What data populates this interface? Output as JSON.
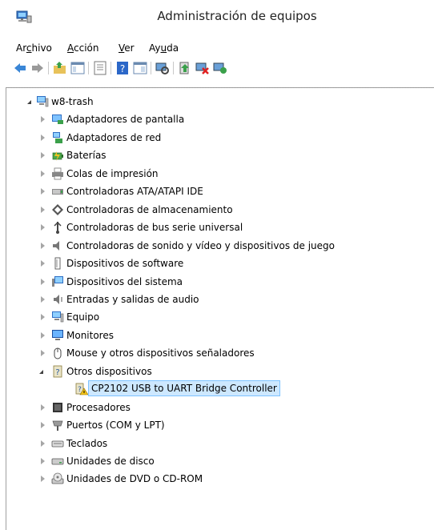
{
  "window": {
    "title": "Administración de equipos"
  },
  "menu": [
    {
      "pre": "Ar",
      "ul": "c",
      "post": "hivo"
    },
    {
      "pre": "",
      "ul": "A",
      "post": "cción"
    },
    {
      "pre": "",
      "ul": "V",
      "post": "er"
    },
    {
      "pre": "Ay",
      "ul": "u",
      "post": "da"
    }
  ],
  "toolbar": {
    "buttons": [
      "back-icon",
      "forward-icon",
      "up-folder-icon",
      "console-tree-icon",
      "properties-icon",
      "help-icon",
      "show-hide-icon",
      "scan-hardware-icon",
      "update-driver-icon",
      "uninstall-icon",
      "enable-device-icon"
    ]
  },
  "tree": {
    "root": "w8-trash",
    "items": [
      {
        "label": "Adaptadores de pantalla",
        "icon": "display-adapter-icon",
        "expanded": false
      },
      {
        "label": "Adaptadores de red",
        "icon": "network-adapter-icon",
        "expanded": false
      },
      {
        "label": "Baterías",
        "icon": "battery-icon",
        "expanded": false
      },
      {
        "label": "Colas de impresión",
        "icon": "printer-icon",
        "expanded": false
      },
      {
        "label": "Controladoras ATA/ATAPI IDE",
        "icon": "ide-controller-icon",
        "expanded": false
      },
      {
        "label": "Controladoras de almacenamiento",
        "icon": "storage-controller-icon",
        "expanded": false
      },
      {
        "label": "Controladoras de bus serie universal",
        "icon": "usb-icon",
        "expanded": false
      },
      {
        "label": "Controladoras de sonido y vídeo y dispositivos de juego",
        "icon": "sound-icon",
        "expanded": false
      },
      {
        "label": "Dispositivos de software",
        "icon": "software-device-icon",
        "expanded": false
      },
      {
        "label": "Dispositivos del sistema",
        "icon": "system-device-icon",
        "expanded": false
      },
      {
        "label": "Entradas y salidas de audio",
        "icon": "audio-io-icon",
        "expanded": false
      },
      {
        "label": "Equipo",
        "icon": "computer-icon",
        "expanded": false
      },
      {
        "label": "Monitores",
        "icon": "monitor-icon",
        "expanded": false
      },
      {
        "label": "Mouse y otros dispositivos señaladores",
        "icon": "mouse-icon",
        "expanded": false
      },
      {
        "label": "Otros dispositivos",
        "icon": "unknown-device-icon",
        "expanded": true,
        "children": [
          {
            "label": "CP2102 USB to UART Bridge Controller",
            "icon": "warning-device-icon",
            "selected": true
          }
        ]
      },
      {
        "label": "Procesadores",
        "icon": "processor-icon",
        "expanded": false
      },
      {
        "label": "Puertos (COM y LPT)",
        "icon": "port-icon",
        "expanded": false
      },
      {
        "label": "Teclados",
        "icon": "keyboard-icon",
        "expanded": false
      },
      {
        "label": "Unidades de disco",
        "icon": "disk-drive-icon",
        "expanded": false
      },
      {
        "label": "Unidades de DVD o CD-ROM",
        "icon": "dvd-drive-icon",
        "expanded": false
      }
    ]
  }
}
